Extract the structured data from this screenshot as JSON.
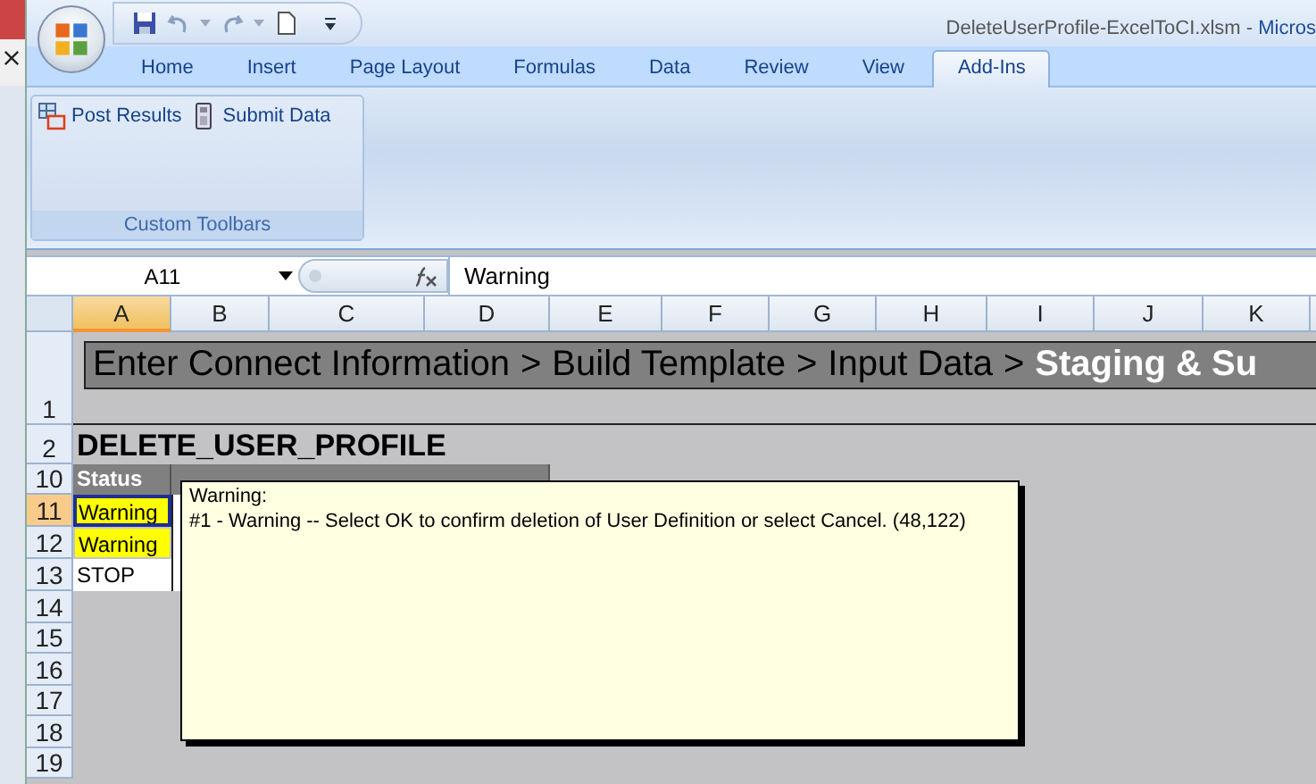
{
  "title": {
    "document": "DeleteUserProfile-ExcelToCI.xlsm",
    "separator": "-",
    "app": "Micros"
  },
  "tabs": [
    {
      "label": "Home",
      "selected": false
    },
    {
      "label": "Insert",
      "selected": false
    },
    {
      "label": "Page Layout",
      "selected": false
    },
    {
      "label": "Formulas",
      "selected": false
    },
    {
      "label": "Data",
      "selected": false
    },
    {
      "label": "Review",
      "selected": false
    },
    {
      "label": "View",
      "selected": false
    },
    {
      "label": "Add-Ins",
      "selected": true
    }
  ],
  "ribbon_group": {
    "buttons": [
      {
        "label": "Post Results",
        "kind": "grid"
      },
      {
        "label": "Submit Data",
        "kind": "device"
      }
    ],
    "label": "Custom Toolbars"
  },
  "name_box": "A11",
  "formula": "Warning",
  "columns": [
    {
      "label": "A",
      "selected": true
    },
    {
      "label": "B",
      "selected": false
    },
    {
      "label": "C",
      "selected": false
    },
    {
      "label": "D",
      "selected": false
    },
    {
      "label": "E",
      "selected": false
    },
    {
      "label": "F",
      "selected": false
    },
    {
      "label": "G",
      "selected": false
    },
    {
      "label": "H",
      "selected": false
    },
    {
      "label": "I",
      "selected": false
    },
    {
      "label": "J",
      "selected": false
    },
    {
      "label": "K",
      "selected": false
    }
  ],
  "rows": [
    {
      "label": "1",
      "selected": false
    },
    {
      "label": "2",
      "selected": false
    },
    {
      "label": "10",
      "selected": false
    },
    {
      "label": "11",
      "selected": true
    },
    {
      "label": "12",
      "selected": false
    },
    {
      "label": "13",
      "selected": false
    },
    {
      "label": "14",
      "selected": false
    },
    {
      "label": "15",
      "selected": false
    },
    {
      "label": "16",
      "selected": false
    },
    {
      "label": "17",
      "selected": false
    },
    {
      "label": "18",
      "selected": false
    },
    {
      "label": "19",
      "selected": false
    }
  ],
  "banner": {
    "separator": ">",
    "steps": [
      {
        "label": "Enter Connect Information",
        "selected": false
      },
      {
        "label": "Build Template",
        "selected": false
      },
      {
        "label": "Input Data",
        "selected": false
      },
      {
        "label": "Staging & Su",
        "selected": true
      }
    ]
  },
  "sheet_title": "DELETE_USER_PROFILE",
  "status_header": "Status",
  "status_cells": [
    {
      "value": "Warning",
      "kind": "warning"
    },
    {
      "value": "Warning",
      "kind": "warning"
    },
    {
      "value": "STOP",
      "kind": "stop"
    }
  ],
  "comment": {
    "title": "Warning:",
    "message": "#1 - Warning -- Select OK to confirm deletion of User Definition or select Cancel. (48,122)"
  }
}
